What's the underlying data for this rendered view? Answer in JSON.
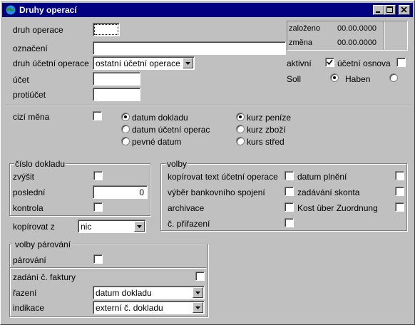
{
  "window": {
    "title": "Druhy operací"
  },
  "top": {
    "druh_operace_label": "druh operace",
    "druh_operace_value": "",
    "oznaceni_label": "označení",
    "oznaceni_value": "",
    "druh_ucetni_label": "druh účetní operace",
    "druh_ucetni_value": "ostatní účetní operace",
    "ucet_label": "účet",
    "ucet_value": "",
    "protiucet_label": "protiúčet",
    "protiucet_value": "",
    "zalozeno_label": "založeno",
    "zalozeno_value": "00.00.0000",
    "zmena_label": "změna",
    "zmena_value": "00.00.0000",
    "aktivni_label": "aktivní",
    "ucetni_osnova_label": "účetní osnova",
    "soll_label": "Soll",
    "haben_label": "Haben"
  },
  "middle": {
    "cizi_mena_label": "cizí měna",
    "datum_dokladu": "datum dokladu",
    "datum_ucetni": "datum účetní operac",
    "pevne_datum": "pevné datum",
    "kurz_penize": "kurz peníze",
    "kurz_zbozi": "kurz zboží",
    "kurs_stred": "kurs střed"
  },
  "cislo_dokladu": {
    "title": "číslo dokladu",
    "zvysit": "zvýšit",
    "posledni": "poslední",
    "posledni_value": "0",
    "kontrola": "kontrola"
  },
  "kopirovat": {
    "label": "kopírovat z",
    "value": "nic"
  },
  "volby": {
    "title": "volby",
    "kopirovat_text": "kopírovat text účetní operace",
    "vyber_bank": "výběr bankovního spojení",
    "archivace": "archivace",
    "c_prirazeni": "č. přiřazení",
    "datum_plneni": "datum plnění",
    "zadavani_skonta": "zadávání skonta",
    "kost": "Kost über Zuordnung"
  },
  "parovani": {
    "title": "volby párování",
    "parovani": "párování",
    "zadani_faktury": "zadání č. faktury",
    "razeni_label": "řazení",
    "razeni_value": "datum dokladu",
    "indikace_label": "indikace",
    "indikace_value": "externí č. dokladu"
  }
}
